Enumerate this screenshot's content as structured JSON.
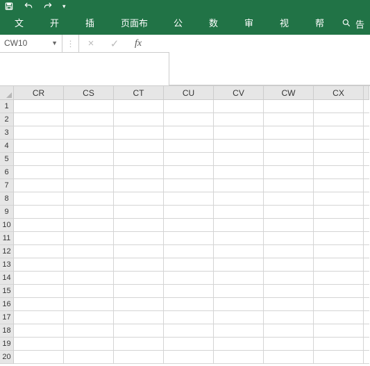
{
  "qat": {
    "save_icon": "save-icon",
    "undo_icon": "undo-icon",
    "redo_icon": "redo-icon",
    "drop_icon": "chevron-down-icon"
  },
  "ribbon": {
    "tabs": [
      "文件",
      "开始",
      "插入",
      "页面布局",
      "公式",
      "数据",
      "审阅",
      "视图",
      "帮助"
    ],
    "tell_me": "告"
  },
  "namebox": {
    "value": "CW10",
    "cancel": "×",
    "enter": "✓",
    "fx": "fx"
  },
  "columns": [
    "CR",
    "CS",
    "CT",
    "CU",
    "CV",
    "CW",
    "CX"
  ],
  "rows": [
    "1",
    "2",
    "3",
    "4",
    "5",
    "6",
    "7",
    "8",
    "9",
    "10",
    "11",
    "12",
    "13",
    "14",
    "15",
    "16",
    "17",
    "18",
    "19",
    "20"
  ],
  "chart_data": null
}
